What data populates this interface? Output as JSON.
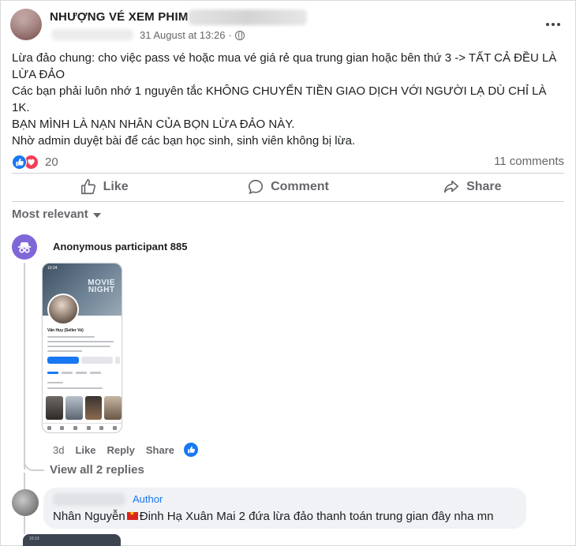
{
  "post": {
    "page_name": "NHƯỢNG VÉ XEM PHIM C",
    "timestamp": "31 August at 13:26",
    "more_icon": "ellipsis-icon",
    "audience_icon": "globe-icon",
    "body_lines": [
      "Lừa đảo chung: cho việc pass vé hoặc mua vé giá rẻ qua trung gian hoặc bên thứ 3 -> TẤT CẢ ĐỀU LÀ LỪA ĐẢO",
      "Các bạn phải luôn nhớ 1 nguyên tắc KHÔNG CHUYỂN TIỀN GIAO DỊCH VỚI NGƯỜI LẠ DÙ CHỈ LÀ 1K.",
      "BẠN MÌNH LÀ NẠN NHÂN CỦA BỌN LỪA ĐẢO NÀY.",
      "Nhờ admin duyệt bài để các bạn học sinh, sinh viên không bị lừa."
    ],
    "reaction_count": "20",
    "comments_count": "11 comments"
  },
  "actions": {
    "like": "Like",
    "comment": "Comment",
    "share": "Share"
  },
  "sort": {
    "label": "Most relevant"
  },
  "comments": [
    {
      "author": "Anonymous participant 885",
      "attachment": {
        "time": "10:24",
        "cover_text_1": "MOVIE",
        "cover_text_2": "NIGHT",
        "profile_name": "Văn Huy (Seller Vé)"
      },
      "time": "3d",
      "like": "Like",
      "reply": "Reply",
      "share": "Share",
      "view_replies": "View all 2 replies"
    },
    {
      "badge": "Author",
      "text_before_flag": "Nhân Nguyễn",
      "text_after_flag": "Đinh Hạ Xuân Mai 2 đứa lừa đảo thanh toán trung gian đây nha mn"
    }
  ],
  "peek": {
    "time": "10:13"
  },
  "colors": {
    "accent": "#1877f2",
    "love": "#f33e58",
    "muted": "#65676b",
    "anon_avatar": "#7f67d8"
  }
}
